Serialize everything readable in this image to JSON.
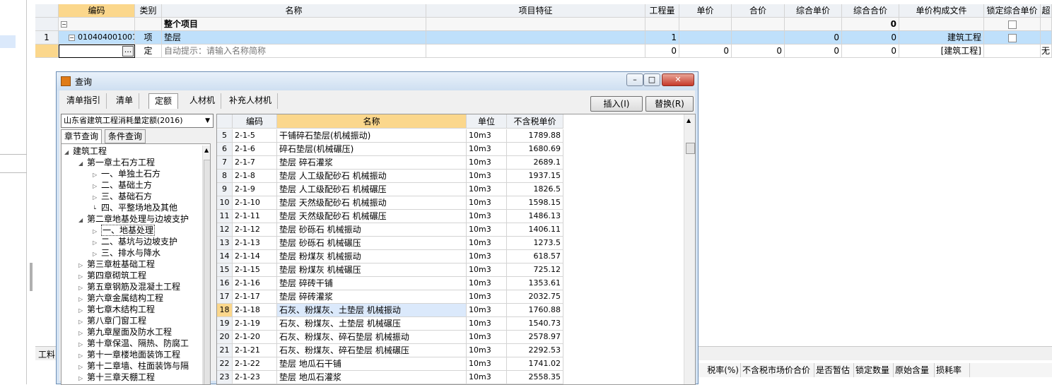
{
  "grid": {
    "headers": [
      "编码",
      "类别",
      "名称",
      "项目特征",
      "工程量",
      "单价",
      "合价",
      "综合单价",
      "综合合价",
      "单价构成文件",
      "锁定综合单价",
      "超"
    ],
    "group_row": {
      "name": "整个项目",
      "total": "0"
    },
    "item_row": {
      "no": "1",
      "code": "010404001001",
      "type": "项",
      "name": "垫层",
      "qty": "1",
      "unit_comp": "0",
      "total_comp": "0",
      "file": "建筑工程"
    },
    "input_row": {
      "ellipsis": "...",
      "type": "定",
      "hint": "自动提示：请输入名称简称",
      "qty": "0",
      "price": "0",
      "sum": "0",
      "unit_comp": "0",
      "total_comp": "0",
      "file": "[建筑工程]",
      "extra": "无"
    }
  },
  "bottom": {
    "tab_label": "工料",
    "cols": [
      "税率(%)",
      "不含税市场价合价",
      "是否暂估",
      "锁定数量",
      "原始含量",
      "损耗率"
    ]
  },
  "dialog": {
    "title": "查询",
    "tabs": [
      "清单指引",
      "清单",
      "定额",
      "人材机",
      "补充人材机"
    ],
    "active_tab": 2,
    "insert_btn": "插入(I)",
    "replace_btn": "替换(R)",
    "quota_lib": "山东省建筑工程消耗量定额(2016)",
    "subtabs": [
      "章节查询",
      "条件查询"
    ],
    "tree": [
      {
        "level": 0,
        "open": true,
        "label": "建筑工程"
      },
      {
        "level": 1,
        "open": true,
        "label": "第一章土石方工程"
      },
      {
        "level": 2,
        "open": false,
        "label": "一、单独土石方"
      },
      {
        "level": 2,
        "open": false,
        "label": "二、基础土方"
      },
      {
        "level": 2,
        "open": false,
        "label": "三、基础石方"
      },
      {
        "level": 2,
        "leaf": true,
        "label": "四、平整场地及其他"
      },
      {
        "level": 1,
        "open": true,
        "label": "第二章地基处理与边坡支护"
      },
      {
        "level": 2,
        "open": false,
        "label": "一、地基处理",
        "selected": true
      },
      {
        "level": 2,
        "open": false,
        "label": "二、基坑与边坡支护"
      },
      {
        "level": 2,
        "open": false,
        "label": "三、排水与降水"
      },
      {
        "level": 1,
        "open": false,
        "label": "第三章桩基础工程"
      },
      {
        "level": 1,
        "open": false,
        "label": "第四章砌筑工程"
      },
      {
        "level": 1,
        "open": false,
        "label": "第五章钢筋及混凝土工程"
      },
      {
        "level": 1,
        "open": false,
        "label": "第六章金属结构工程"
      },
      {
        "level": 1,
        "open": false,
        "label": "第七章木结构工程"
      },
      {
        "level": 1,
        "open": false,
        "label": "第八章门窗工程"
      },
      {
        "level": 1,
        "open": false,
        "label": "第九章屋面及防水工程"
      },
      {
        "level": 1,
        "open": false,
        "label": "第十章保温、隔热、防腐工"
      },
      {
        "level": 1,
        "open": false,
        "label": "第十一章楼地面装饰工程"
      },
      {
        "level": 1,
        "open": false,
        "label": "第十二章墙、柱面装饰与隔"
      },
      {
        "level": 1,
        "open": false,
        "label": "第十三章天棚工程"
      }
    ],
    "list_headers": [
      "编码",
      "名称",
      "单位",
      "不含税单价"
    ],
    "list": [
      {
        "no": "5",
        "code": "2-1-5",
        "name": "干铺碎石垫层(机械振动)",
        "unit": "10m3",
        "price": "1789.88"
      },
      {
        "no": "6",
        "code": "2-1-6",
        "name": "碎石垫层(机械碾压)",
        "unit": "10m3",
        "price": "1680.69"
      },
      {
        "no": "7",
        "code": "2-1-7",
        "name": "垫层 碎石灌浆",
        "unit": "10m3",
        "price": "2689.1"
      },
      {
        "no": "8",
        "code": "2-1-8",
        "name": "垫层 人工级配砂石 机械振动",
        "unit": "10m3",
        "price": "1937.15"
      },
      {
        "no": "9",
        "code": "2-1-9",
        "name": "垫层 人工级配砂石 机械碾压",
        "unit": "10m3",
        "price": "1826.5"
      },
      {
        "no": "10",
        "code": "2-1-10",
        "name": "垫层 天然级配砂石 机械振动",
        "unit": "10m3",
        "price": "1598.15"
      },
      {
        "no": "11",
        "code": "2-1-11",
        "name": "垫层 天然级配砂石 机械碾压",
        "unit": "10m3",
        "price": "1486.13"
      },
      {
        "no": "12",
        "code": "2-1-12",
        "name": "垫层 砂砾石 机械振动",
        "unit": "10m3",
        "price": "1406.11"
      },
      {
        "no": "13",
        "code": "2-1-13",
        "name": "垫层 砂砾石 机械碾压",
        "unit": "10m3",
        "price": "1273.5"
      },
      {
        "no": "14",
        "code": "2-1-14",
        "name": "垫层 粉煤灰 机械振动",
        "unit": "10m3",
        "price": "618.57"
      },
      {
        "no": "15",
        "code": "2-1-15",
        "name": "垫层 粉煤灰 机械碾压",
        "unit": "10m3",
        "price": "725.12"
      },
      {
        "no": "16",
        "code": "2-1-16",
        "name": "垫层 碎砖干铺",
        "unit": "10m3",
        "price": "1353.61"
      },
      {
        "no": "17",
        "code": "2-1-17",
        "name": "垫层 碎砖灌浆",
        "unit": "10m3",
        "price": "2032.75"
      },
      {
        "no": "18",
        "code": "2-1-18",
        "name": "石灰、粉煤灰、土垫层 机械振动",
        "unit": "10m3",
        "price": "1760.88",
        "selected": true
      },
      {
        "no": "19",
        "code": "2-1-19",
        "name": "石灰、粉煤灰、土垫层 机械碾压",
        "unit": "10m3",
        "price": "1540.73"
      },
      {
        "no": "20",
        "code": "2-1-20",
        "name": "石灰、粉煤灰、碎石垫层 机械振动",
        "unit": "10m3",
        "price": "2578.97"
      },
      {
        "no": "21",
        "code": "2-1-21",
        "name": "石灰、粉煤灰、碎石垫层 机械碾压",
        "unit": "10m3",
        "price": "2292.53"
      },
      {
        "no": "22",
        "code": "2-1-22",
        "name": "垫层 地瓜石干铺",
        "unit": "10m3",
        "price": "1741.02"
      },
      {
        "no": "23",
        "code": "2-1-23",
        "name": "垫层 地瓜石灌浆",
        "unit": "10m3",
        "price": "2558.35"
      }
    ]
  }
}
